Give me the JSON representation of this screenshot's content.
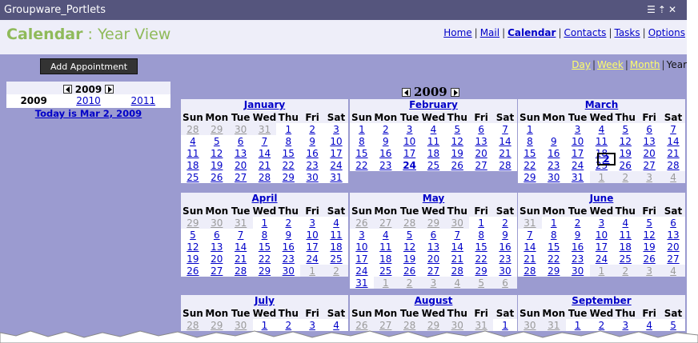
{
  "window": {
    "title": "Groupware_Portlets",
    "icons": [
      "list-icon",
      "up-icon",
      "close-icon"
    ]
  },
  "app": {
    "title": "Calendar",
    "separator": " : ",
    "subtitle": "Year View"
  },
  "nav": {
    "links": [
      {
        "label": "Home",
        "active": false
      },
      {
        "label": "Mail",
        "active": false
      },
      {
        "label": "Calendar",
        "active": true
      },
      {
        "label": "Contacts",
        "active": false
      },
      {
        "label": "Tasks",
        "active": false
      },
      {
        "label": "Options",
        "active": false
      }
    ]
  },
  "toolbar": {
    "add_label": "Add Appointment"
  },
  "views": {
    "day": "Day",
    "week": "Week",
    "month": "Month",
    "year": "Year"
  },
  "mini": {
    "year": "2009",
    "years": [
      "2009",
      "2010",
      "2011"
    ],
    "today": "Today is Mar 2, 2009"
  },
  "year_label": "2009",
  "day_headers": [
    "Sun",
    "Mon",
    "Tue",
    "Wed",
    "Thu",
    "Fri",
    "Sat"
  ],
  "months": [
    {
      "name": "January",
      "first": 4,
      "days": 31,
      "prev": 31,
      "rows": 5
    },
    {
      "name": "February",
      "first": 0,
      "days": 28,
      "prev": 31,
      "rows": 4,
      "bold": 24
    },
    {
      "name": "March",
      "first": 0,
      "days": 31,
      "prev": 28,
      "rows": 5,
      "today": 2
    },
    {
      "name": "April",
      "first": 3,
      "days": 30,
      "prev": 31,
      "rows": 5
    },
    {
      "name": "May",
      "first": 5,
      "days": 31,
      "prev": 30,
      "rows": 6
    },
    {
      "name": "June",
      "first": 1,
      "days": 30,
      "prev": 31,
      "rows": 5
    },
    {
      "name": "July",
      "first": 3,
      "days": 31,
      "prev": 30,
      "rows": 1
    },
    {
      "name": "August",
      "first": 6,
      "days": 31,
      "prev": 31,
      "rows": 1
    },
    {
      "name": "September",
      "first": 2,
      "days": 30,
      "prev": 31,
      "rows": 1
    }
  ]
}
